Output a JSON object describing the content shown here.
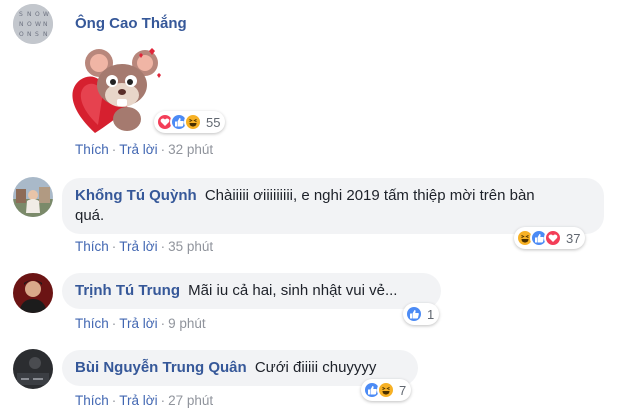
{
  "comments": [
    {
      "name": "Ông Cao Thắng",
      "text": "",
      "sticker": "mouse-heart-sticker",
      "reactions": [
        "love",
        "like",
        "haha"
      ],
      "reaction_count": "55",
      "like_label": "Thích",
      "reply_label": "Trả lời",
      "time": "32 phút"
    },
    {
      "name": "Khổng Tú Quỳnh",
      "text": "Chàiiiii ơiiiiiiiii, e nghi 2019 tấm thiệp mời trên bàn",
      "text2": "quá.",
      "reactions": [
        "haha",
        "like",
        "love"
      ],
      "reaction_count": "37",
      "like_label": "Thích",
      "reply_label": "Trả lời",
      "time": "35 phút"
    },
    {
      "name": "Trịnh Tú Trung",
      "text": "Mãi iu cả hai, sinh nhật vui vẻ...",
      "reactions": [
        "like"
      ],
      "reaction_count": "1",
      "like_label": "Thích",
      "reply_label": "Trả lời",
      "time": "9 phút"
    },
    {
      "name": "Bùi Nguyễn Trung Quân",
      "text": "Cưới điiiii chuyyyy",
      "reactions": [
        "like",
        "haha"
      ],
      "reaction_count": "7",
      "like_label": "Thích",
      "reply_label": "Trả lời",
      "time": "27 phút"
    }
  ],
  "colors": {
    "name": "#365899",
    "link": "#4267b2",
    "meta": "#90949c",
    "bubble": "#f2f3f5",
    "like": "#4c8bf5",
    "love": "#f33e58",
    "haha": "#f7b125"
  }
}
